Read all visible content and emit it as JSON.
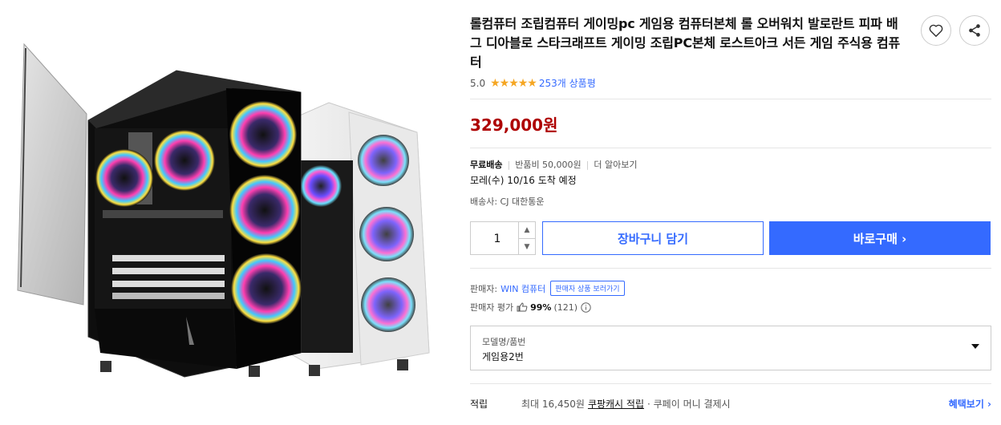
{
  "product": {
    "title": "롤컴퓨터 조립컴퓨터 게이밍pc 게임용 컴퓨터본체 롤 오버워치 발로란트 피파 배그 디아블로 스타크래프트 게이밍 조립PC본체 로스트아크 서든 게임 주식용 컴퓨터",
    "rating": "5.0",
    "stars": "★★★★★",
    "review_count": "253개 상품평",
    "price": "329,000원"
  },
  "shipping": {
    "free_label": "무료배송",
    "return_fee": "반품비 50,000원",
    "more": "더 알아보기",
    "arrival": "모레(수) 10/16 도착 예정",
    "carrier": "배송사: CJ 대한통운"
  },
  "purchase": {
    "quantity": "1",
    "qty_up": "▲",
    "qty_down": "▼",
    "cart_label": "장바구니 담기",
    "buy_label": "바로구매 ›"
  },
  "seller": {
    "label": "판매자:",
    "name": "WIN 컴퓨터",
    "tag": "판매자 상품 보러가기",
    "rating_label": "판매자 평가",
    "rating_value": "99%",
    "rating_count": "(121)"
  },
  "option": {
    "label": "모델명/품번",
    "value": "게임용2번"
  },
  "reward": {
    "label": "적립",
    "text_prefix": "최대 16,450원",
    "cash_link": "쿠팡캐시 적립",
    "text_suffix": "· 쿠페이 머니 결제시",
    "benefit": "혜택보기 ›"
  },
  "icons": {
    "heart": "heart-icon",
    "share": "share-icon",
    "thumb": "thumbs-up-icon",
    "info": "info-icon"
  },
  "colors": {
    "accent": "#346aff",
    "price": "#ae0000",
    "star": "#f5a623"
  }
}
